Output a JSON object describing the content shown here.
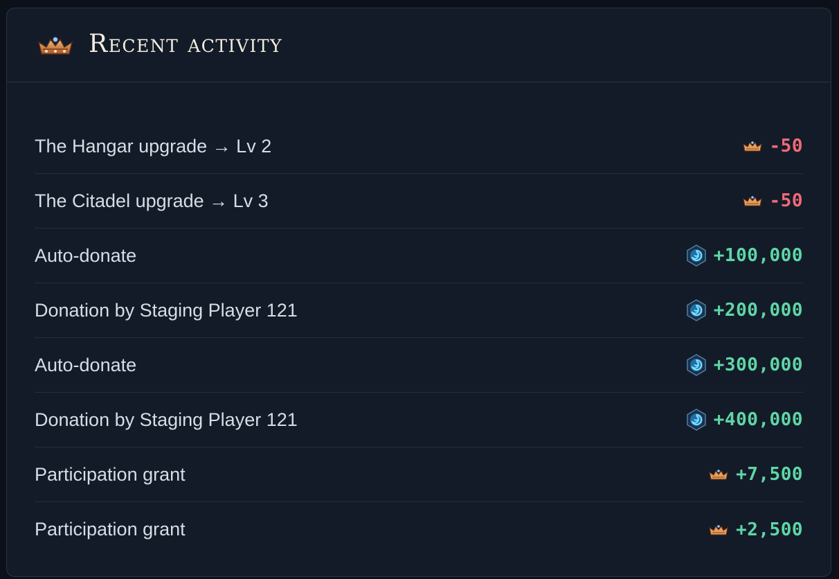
{
  "header": {
    "title": "Recent activity",
    "icon": "crown-icon"
  },
  "colors": {
    "negative": "#f06a77",
    "positive": "#5fd6a6",
    "background": "#131b28",
    "text": "#d7dde6"
  },
  "activity": [
    {
      "description": "The Hangar upgrade → Lv 2",
      "amount": "-50",
      "currency_icon": "crown-icon",
      "sign": "negative"
    },
    {
      "description": "The Citadel upgrade → Lv 3",
      "amount": "-50",
      "currency_icon": "crown-icon",
      "sign": "negative"
    },
    {
      "description": "Auto-donate",
      "amount": "+100,000",
      "currency_icon": "vortex-coin-icon",
      "sign": "positive"
    },
    {
      "description": "Donation by Staging Player 121",
      "amount": "+200,000",
      "currency_icon": "vortex-coin-icon",
      "sign": "positive"
    },
    {
      "description": "Auto-donate",
      "amount": "+300,000",
      "currency_icon": "vortex-coin-icon",
      "sign": "positive"
    },
    {
      "description": "Donation by Staging Player 121",
      "amount": "+400,000",
      "currency_icon": "vortex-coin-icon",
      "sign": "positive"
    },
    {
      "description": "Participation grant",
      "amount": "+7,500",
      "currency_icon": "crown-icon",
      "sign": "positive"
    },
    {
      "description": "Participation grant",
      "amount": "+2,500",
      "currency_icon": "crown-icon",
      "sign": "positive"
    }
  ]
}
